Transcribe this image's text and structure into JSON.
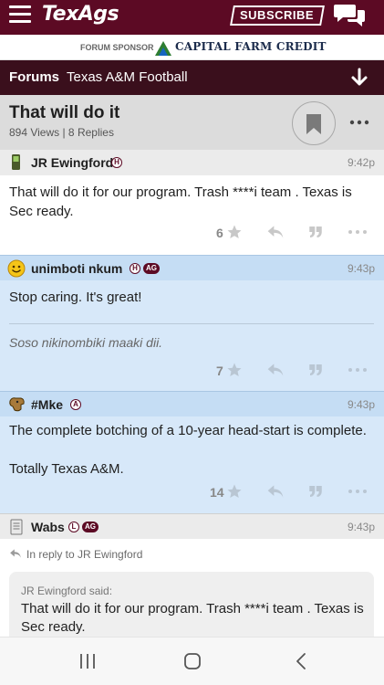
{
  "header": {
    "logo": "TexAgs",
    "subscribe_label": "SUBSCRIBE",
    "brand_color": "#5c0a24"
  },
  "sponsor": {
    "label": "FORUM SPONSOR",
    "name": "CAPITAL FARM CREDIT"
  },
  "breadcrumb": {
    "forums": "Forums",
    "board": "Texas A&M Football"
  },
  "thread": {
    "title": "That will do it",
    "meta": "894 Views | 8 Replies"
  },
  "posts": [
    {
      "username": "JR Ewingford",
      "badges": [
        "H"
      ],
      "time": "9:42p",
      "text": "That will do it for our program. Trash ****i team . Texas is Sec ready.",
      "stars": "6"
    },
    {
      "username": "unimboti nkum",
      "badges": [
        "H",
        "AG"
      ],
      "time": "9:43p",
      "text": "Stop caring. It's great!",
      "signature": "Soso nikinombiki maaki dii.",
      "stars": "7"
    },
    {
      "username": "#Mke",
      "badges": [
        "A"
      ],
      "time": "9:43p",
      "text": "The complete botching of a 10-year head-start is complete.\n\nTotally Texas A&M.",
      "stars": "14"
    },
    {
      "username": "Wabs",
      "badges": [
        "L",
        "AG"
      ],
      "time": "9:43p",
      "reply_to": "In reply to JR Ewingford",
      "quote_by": "JR Ewingford said:",
      "quote_text": "That will do it for our program. Trash ****i team . Texas is Sec ready."
    }
  ],
  "icons": {
    "menu": "hamburger-icon",
    "chat": "chat-bubbles-icon",
    "jump": "arrow-down-icon",
    "bookmark": "bookmark-icon",
    "more": "ellipsis-icon",
    "star": "star-icon",
    "reply": "reply-arrow-icon",
    "quote": "quote-icon"
  }
}
